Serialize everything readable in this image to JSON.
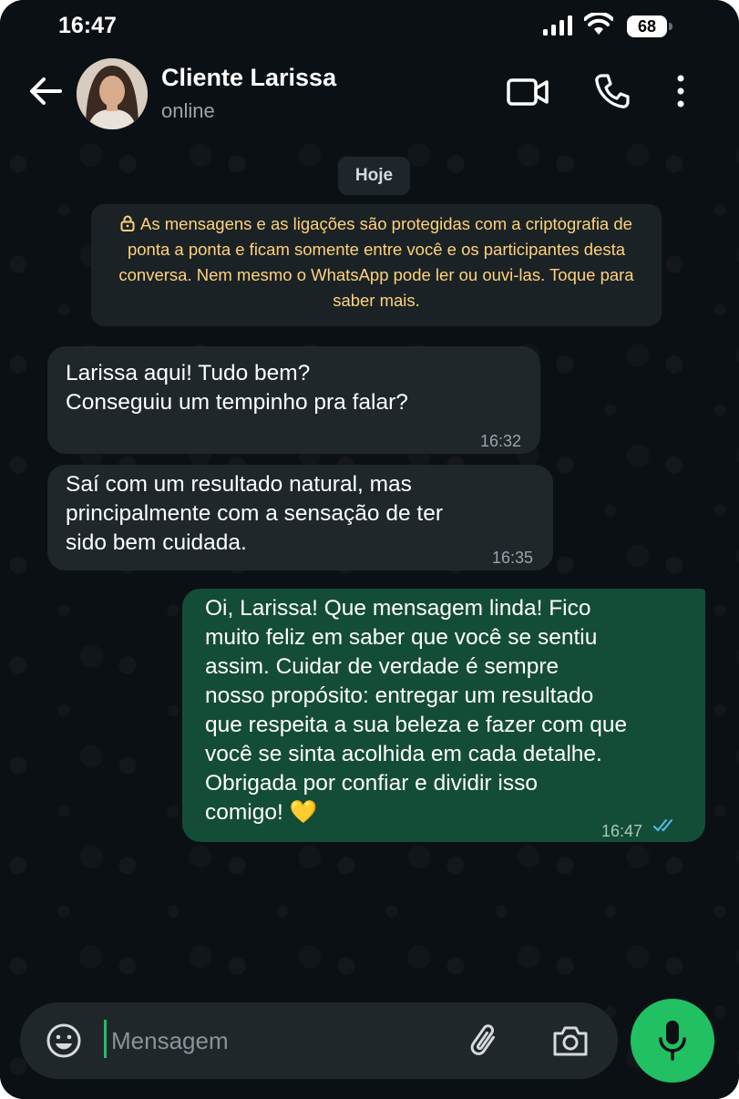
{
  "status_bar": {
    "time": "16:47",
    "battery": "68"
  },
  "header": {
    "contact_name": "Cliente Larissa",
    "contact_status": "online"
  },
  "chat": {
    "date_chip": "Hoje",
    "encryption_notice": "As mensagens e as ligações são protegidas com a criptografia de ponta a ponta e ficam somente entre você e os participantes desta conversa. Nem mesmo o WhatsApp pode ler ou ouvi-las. Toque para saber mais.",
    "messages": [
      {
        "direction": "incoming",
        "lines": [
          "Larissa aqui! Tudo bem?",
          "Conseguiu um tempinho pra falar?"
        ],
        "time": "16:32"
      },
      {
        "direction": "incoming",
        "lines": [
          "Saí com um resultado natural, mas",
          "principalmente com a sensação de ter",
          "sido bem cuidada."
        ],
        "time": "16:35"
      },
      {
        "direction": "outgoing",
        "lines": [
          "Oi, Larissa! Que mensagem linda! Fico",
          "muito feliz em saber que você se sentiu",
          "assim. Cuidar de verdade é sempre",
          "nosso propósito: entregar um resultado",
          "que respeita a sua beleza e fazer com que",
          "você se sinta acolhida em cada detalhe.",
          "Obrigada por confiar e dividir isso",
          "comigo! 💛"
        ],
        "time": "16:47",
        "read": true
      }
    ]
  },
  "composer": {
    "placeholder": "Mensagem"
  },
  "colors": {
    "accent": "#21c063",
    "outgoing_bubble": "#144d37",
    "incoming_bubble": "#1f272b",
    "notice_text": "#ffd279",
    "read_ticks": "#53bdeb"
  },
  "icons": [
    "back-arrow-icon",
    "video-call-icon",
    "voice-call-icon",
    "more-options-icon",
    "lock-icon",
    "emoji-icon",
    "attach-icon",
    "camera-icon",
    "mic-icon",
    "double-check-icon"
  ]
}
